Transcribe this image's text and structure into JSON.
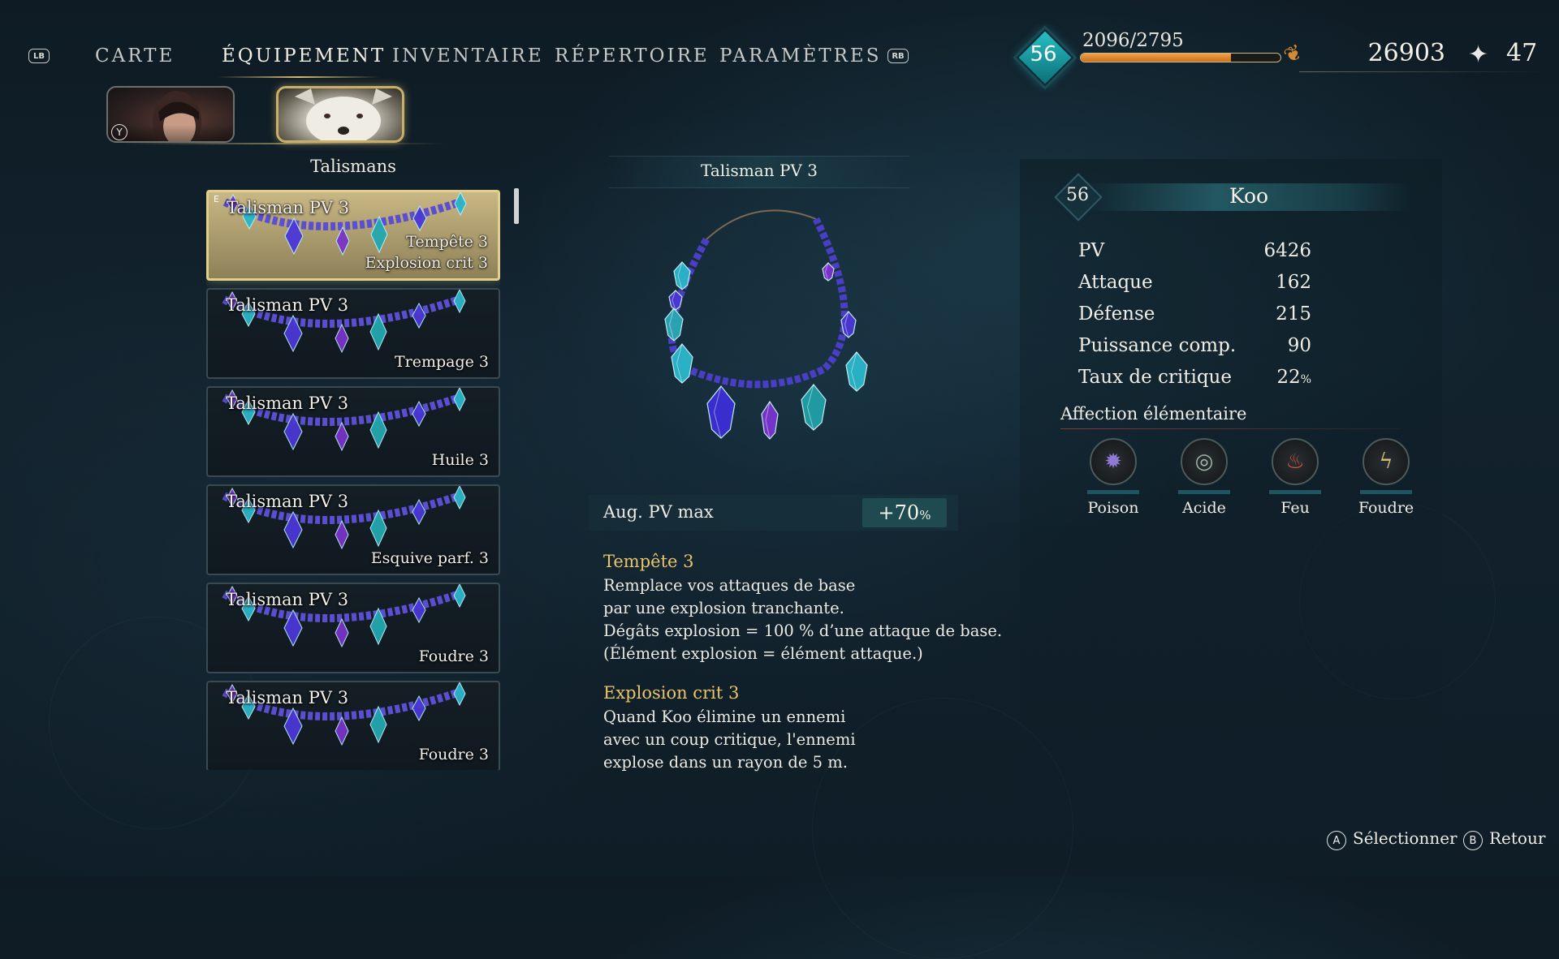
{
  "nav": {
    "lb": "LB",
    "rb": "RB",
    "tabs": [
      "CARTE",
      "ÉQUIPEMENT",
      "INVENTAIRE",
      "RÉPERTOIRE",
      "PARAMÈTRES"
    ],
    "active_tab": "ÉQUIPEMENT"
  },
  "hud": {
    "level": "56",
    "xp_text": "2096/2795",
    "xp_fraction": 0.75,
    "money": "26903",
    "gems": "47"
  },
  "portraits": {
    "y_button": "Y",
    "selected": "wolf"
  },
  "list": {
    "title": "Talismans",
    "equipped_marker": "E",
    "items": [
      {
        "name": "Talisman PV 3",
        "perks": [
          "Tempête 3",
          "Explosion crit 3"
        ],
        "selected": true
      },
      {
        "name": "Talisman PV 3",
        "perks": [
          "Trempage 3"
        ]
      },
      {
        "name": "Talisman PV 3",
        "perks": [
          "Huile 3"
        ]
      },
      {
        "name": "Talisman PV 3",
        "perks": [
          "Esquive parf. 3"
        ]
      },
      {
        "name": "Talisman PV 3",
        "perks": [
          "Foudre 3"
        ]
      },
      {
        "name": "Talisman PV 3",
        "perks": [
          "Foudre 3"
        ]
      }
    ]
  },
  "detail": {
    "title": "Talisman PV 3",
    "stat_label": "Aug. PV max",
    "stat_value": "+70",
    "stat_unit": "%",
    "perks": [
      {
        "title": "Tempête 3",
        "lines": [
          "Remplace vos attaques de base",
          "par une explosion tranchante.",
          "Dégâts explosion = 100 % d’une attaque de base.",
          "(Élément explosion = élément attaque.)"
        ]
      },
      {
        "title": "Explosion crit 3",
        "lines": [
          "Quand Koo élimine un ennemi",
          "avec un coup critique, l'ennemi",
          "explose dans un rayon de 5 m."
        ]
      }
    ]
  },
  "character": {
    "level": "56",
    "name": "Koo",
    "stats": [
      {
        "label": "PV",
        "value": "6426"
      },
      {
        "label": "Attaque",
        "value": "162"
      },
      {
        "label": "Défense",
        "value": "215"
      },
      {
        "label": "Puissance comp.",
        "value": "90"
      },
      {
        "label": "Taux de critique",
        "value": "22",
        "unit": "%"
      }
    ],
    "affinity_title": "Affection élémentaire",
    "affinities": [
      {
        "label": "Poison",
        "icon": "poison-icon",
        "color": "#8f7ad8"
      },
      {
        "label": "Acide",
        "icon": "acid-icon",
        "color": "#9fb7a6"
      },
      {
        "label": "Feu",
        "icon": "fire-icon",
        "color": "#e0533c"
      },
      {
        "label": "Foudre",
        "icon": "lightning-icon",
        "color": "#d8c070"
      }
    ]
  },
  "footer": {
    "select_btn": "A",
    "select_label": "Sélectionner",
    "back_btn": "B",
    "back_label": "Retour"
  }
}
